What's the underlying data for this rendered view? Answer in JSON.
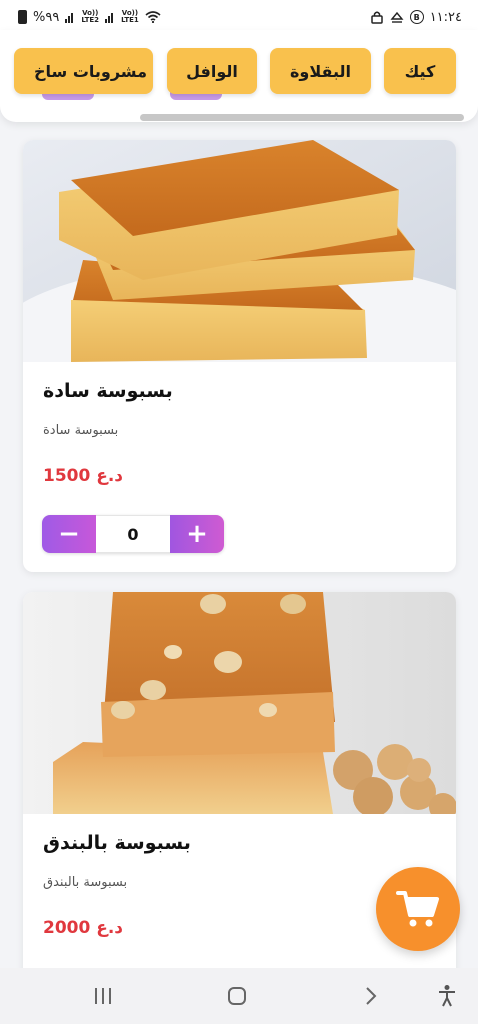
{
  "status_bar": {
    "battery": "%٩٩",
    "net1": {
      "top": "Vo))",
      "bottom": "LTE2"
    },
    "net2": {
      "top": "Vo))",
      "bottom": "LTE1"
    },
    "time": "١١:٢٤",
    "b_badge": "B"
  },
  "categories": [
    {
      "label": "كيك"
    },
    {
      "label": "البقلاوة"
    },
    {
      "label": "الوافل"
    },
    {
      "label": "مشروبات ساخ"
    }
  ],
  "products": [
    {
      "title": "بسبوسة سادة",
      "description": "بسبوسة سادة",
      "price": "1500 د.ع",
      "quantity": "0",
      "minus_label": "−",
      "plus_label": "+"
    },
    {
      "title": "بسبوسة بالبندق",
      "description": "بسبوسة بالبندق",
      "price": "2000 د.ع"
    }
  ],
  "icons": {
    "cart": "shopping-cart-icon",
    "recents": "recents-icon",
    "home": "home-icon",
    "back": "back-icon",
    "accessibility": "accessibility-icon"
  },
  "colors": {
    "category_chip": "#f9c14d",
    "price": "#e0383e",
    "stepper": "#b158de",
    "fab": "#f7902c"
  }
}
